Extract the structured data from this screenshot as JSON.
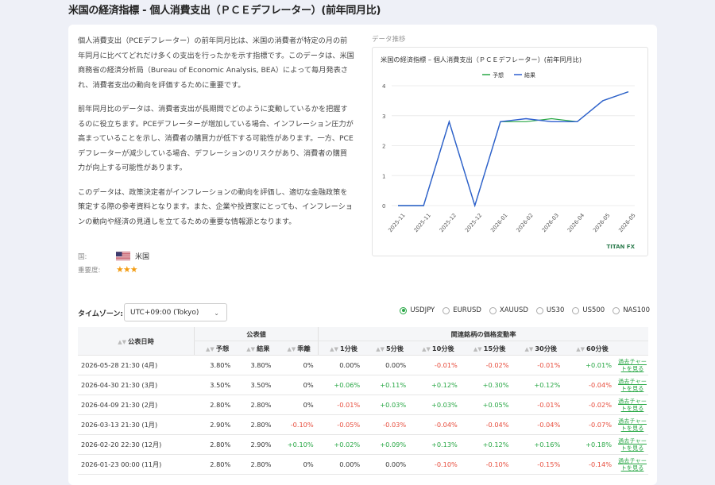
{
  "page": {
    "title": "米国の経済指標 - 個人消費支出（ＰＣＥデフレーター）(前年同月比)"
  },
  "description": [
    "個人消費支出（PCEデフレーター）の前年同月比は、米国の消費者が特定の月の前年同月に比べてどれだけ多くの支出を行ったかを示す指標です。このデータは、米国商務省の経済分析局（Bureau of Economic Analysis, BEA）によって毎月発表され、消費者支出の動向を評価するために重要です。",
    "前年同月比のデータは、消費者支出が長期間でどのように変動しているかを把握するのに役立ちます。PCEデフレーターが増加している場合、インフレーション圧力が高まっていることを示し、消費者の購買力が低下する可能性があります。一方、PCEデフレーターが減少している場合、デフレーションのリスクがあり、消費者の購買力が向上する可能性があります。",
    "このデータは、政策決定者がインフレーションの動向を評価し、適切な金融政策を策定する際の参考資料となります。また、企業や投資家にとっても、インフレーションの動向や経済の見通しを立てるための重要な情報源となります。"
  ],
  "meta": {
    "country_label": "国:",
    "country": "米国",
    "importance_label": "重要度:",
    "stars": "★★★"
  },
  "chart": {
    "section_label": "データ推移",
    "brand": "TITAN FX",
    "colors": {
      "forecast": "#28a745",
      "actual": "#2f5fd0"
    },
    "chart_data": {
      "type": "line",
      "title": "米国の経済指標 – 個人消費支出（ＰＣＥデフレーター）(前年同月比)",
      "categories": [
        "2025-11",
        "2025-11",
        "2025-12",
        "2025-12",
        "2026-01",
        "2026-02",
        "2026-03",
        "2026-04",
        "2026-05",
        "2026-05"
      ],
      "series": [
        {
          "name": "予想",
          "values": [
            0,
            0,
            2.8,
            0,
            2.8,
            2.8,
            2.9,
            2.8,
            3.5,
            3.8
          ]
        },
        {
          "name": "結果",
          "values": [
            0,
            0,
            2.8,
            0,
            2.8,
            2.9,
            2.8,
            2.8,
            3.5,
            3.8
          ]
        }
      ],
      "ylim": [
        0,
        4
      ],
      "yticks": [
        0,
        1,
        2,
        3,
        4
      ],
      "grid": true,
      "legend_position": "top"
    }
  },
  "controls": {
    "timezone_label": "タイムゾーン:",
    "timezone_value": "UTC+09:00 (Tokyo)",
    "symbols": [
      "USDJPY",
      "EURUSD",
      "XAUUSD",
      "US30",
      "US500",
      "NAS100"
    ],
    "selected_symbol": "USDJPY"
  },
  "table": {
    "group_headers": {
      "date": "公表日時",
      "published": "公表値",
      "change": "関連銘柄の価格変動率"
    },
    "sub_headers": {
      "forecast": "予想",
      "actual": "結果",
      "deviation": "乖離",
      "m1": "1分後",
      "m5": "5分後",
      "m10": "10分後",
      "m15": "15分後",
      "m30": "30分後",
      "m60": "60分後"
    },
    "link_label": "過去チャートを見る",
    "rows": [
      {
        "date": "2026-05-28 21:30 (4月)",
        "forecast": "3.80%",
        "actual": "3.80%",
        "deviation": "0%",
        "m1": "0.00%",
        "m5": "0.00%",
        "m10": "-0.01%",
        "m15": "-0.02%",
        "m30": "-0.01%",
        "m60": "+0.01%"
      },
      {
        "date": "2026-04-30 21:30 (3月)",
        "forecast": "3.50%",
        "actual": "3.50%",
        "deviation": "0%",
        "m1": "+0.06%",
        "m5": "+0.11%",
        "m10": "+0.12%",
        "m15": "+0.30%",
        "m30": "+0.12%",
        "m60": "-0.04%"
      },
      {
        "date": "2026-04-09 21:30 (2月)",
        "forecast": "2.80%",
        "actual": "2.80%",
        "deviation": "0%",
        "m1": "-0.01%",
        "m5": "+0.03%",
        "m10": "+0.03%",
        "m15": "+0.05%",
        "m30": "-0.01%",
        "m60": "-0.02%"
      },
      {
        "date": "2026-03-13 21:30 (1月)",
        "forecast": "2.90%",
        "actual": "2.80%",
        "deviation": "-0.10%",
        "m1": "-0.05%",
        "m5": "-0.03%",
        "m10": "-0.04%",
        "m15": "-0.04%",
        "m30": "-0.04%",
        "m60": "-0.07%"
      },
      {
        "date": "2026-02-20 22:30 (12月)",
        "forecast": "2.80%",
        "actual": "2.90%",
        "deviation": "+0.10%",
        "m1": "+0.02%",
        "m5": "+0.09%",
        "m10": "+0.13%",
        "m15": "+0.12%",
        "m30": "+0.16%",
        "m60": "+0.18%"
      },
      {
        "date": "2026-01-23 00:00 (11月)",
        "forecast": "2.80%",
        "actual": "2.80%",
        "deviation": "0%",
        "m1": "0.00%",
        "m5": "0.00%",
        "m10": "-0.10%",
        "m15": "-0.10%",
        "m30": "-0.15%",
        "m60": "-0.14%"
      }
    ]
  }
}
